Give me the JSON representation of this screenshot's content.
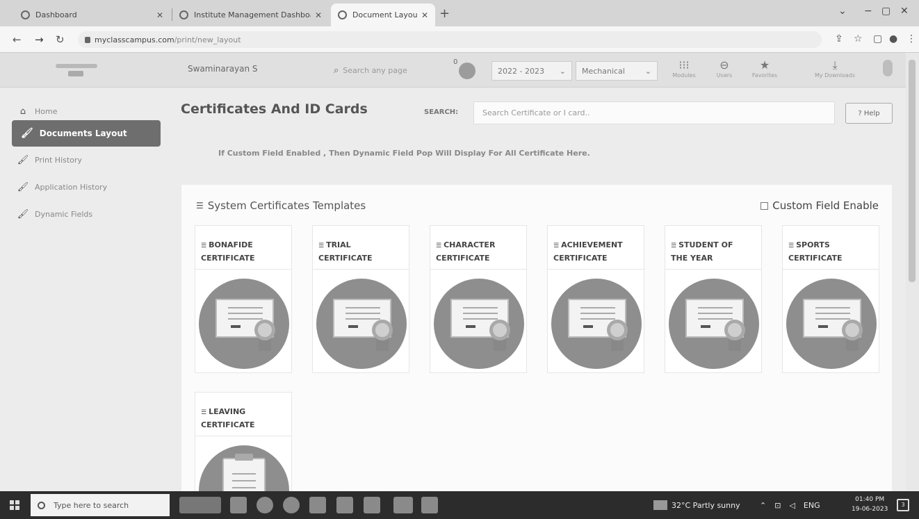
{
  "browser": {
    "tabs": [
      {
        "label": "Dashboard",
        "active": false
      },
      {
        "label": "Institute Management Dashboar",
        "active": false
      },
      {
        "label": "Document Layout",
        "active": true
      }
    ],
    "new_tab": "+",
    "url_host": "myclasscampus.com",
    "url_path": "/print/new_layout",
    "minimize": "−",
    "maximize": "▢",
    "close": "✕",
    "chevron": "⌄"
  },
  "header": {
    "institute_name": "Swaminarayan S",
    "search_placeholder": "Search any page",
    "notification_count": "0",
    "year": "2022 - 2023",
    "department": "Mechanical",
    "icons": [
      {
        "label": "Modules",
        "glyph": "⁝⁝⁝",
        "icon": "grid-icon"
      },
      {
        "label": "Users",
        "glyph": "⊖",
        "icon": "users-icon"
      },
      {
        "label": "Favorites",
        "glyph": "★",
        "icon": "star-icon"
      },
      {
        "label": "My Downloads",
        "glyph": "⤓",
        "icon": "download-icon"
      }
    ]
  },
  "sidebar": {
    "items": [
      {
        "label": "Home",
        "icon": "home-icon",
        "active": false
      },
      {
        "label": "Documents Layout",
        "icon": "brush-icon",
        "active": true
      },
      {
        "label": "Print History",
        "icon": "brush-icon",
        "active": false
      },
      {
        "label": "Application History",
        "icon": "brush-icon",
        "active": false
      },
      {
        "label": "Dynamic Fields",
        "icon": "brush-icon",
        "active": false
      }
    ]
  },
  "main": {
    "title": "Certificates And ID Cards",
    "search_label": "SEARCH:",
    "search_placeholder": "Search Certificate or I card..",
    "help_label": "? Help",
    "info_message": "If Custom Field Enabled , Then Dynamic Field Pop Will Display For All Certificate Here.",
    "section_title": "System Certificates Templates",
    "custom_field_label": "Custom Field Enable",
    "custom_field_checked": false,
    "templates": [
      {
        "line1": "BONAFIDE",
        "line2": "CERTIFICATE",
        "art": "certificate"
      },
      {
        "line1": "TRIAL",
        "line2": "CERTIFICATE",
        "art": "certificate"
      },
      {
        "line1": "CHARACTER",
        "line2": "CERTIFICATE",
        "art": "certificate"
      },
      {
        "line1": "ACHIEVEMENT",
        "line2": "CERTIFICATE",
        "art": "certificate"
      },
      {
        "line1": "STUDENT OF",
        "line2": "THE YEAR",
        "art": "certificate"
      },
      {
        "line1": "SPORTS",
        "line2": "CERTIFICATE",
        "art": "certificate"
      },
      {
        "line1": "LEAVING",
        "line2": "CERTIFICATE",
        "art": "clipboard"
      }
    ]
  },
  "taskbar": {
    "search_placeholder": "Type here to search",
    "weather": "32°C  Partly sunny",
    "language": "ENG",
    "time": "01:40 PM",
    "date": "19-06-2023",
    "notification_count": "3"
  }
}
